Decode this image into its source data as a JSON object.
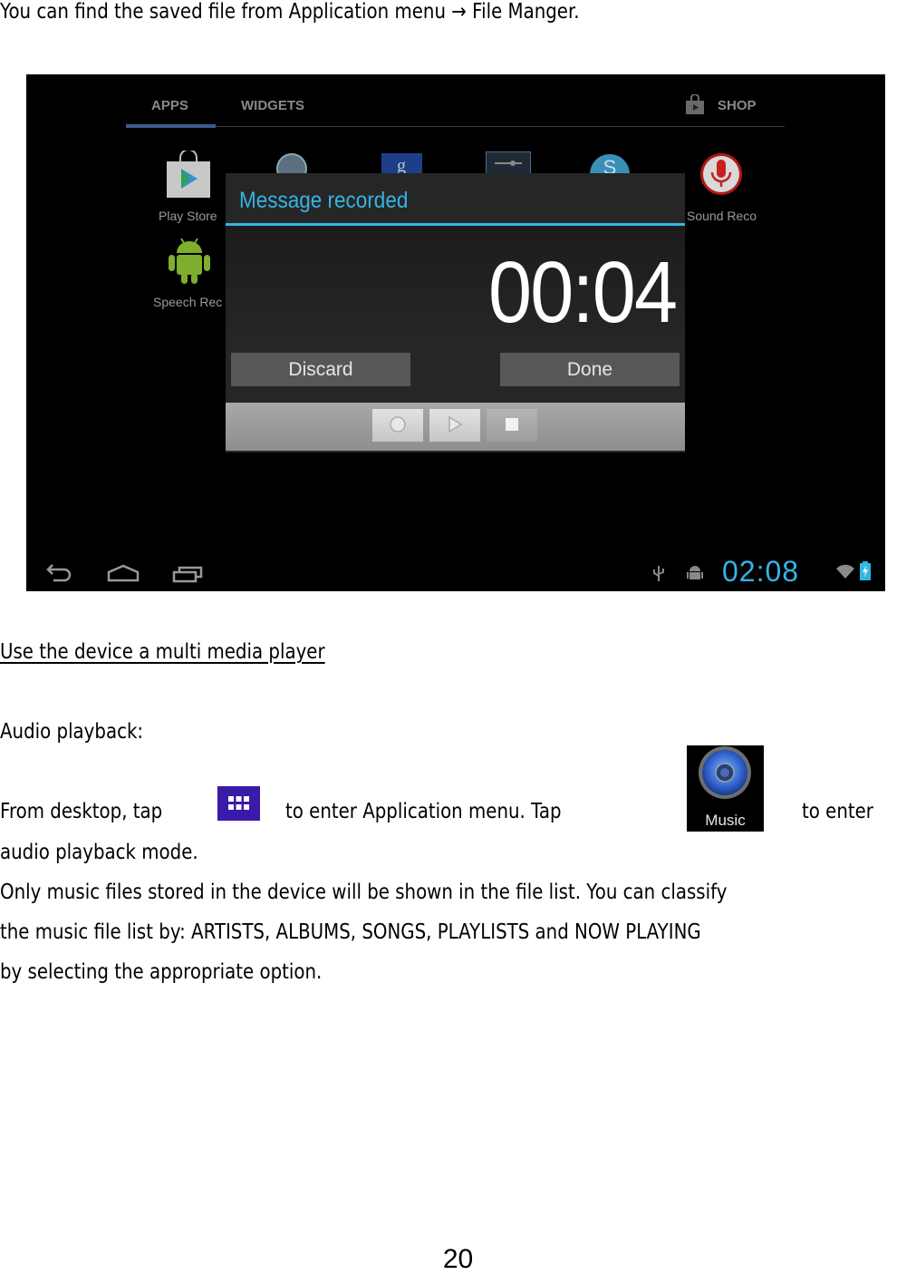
{
  "intro": {
    "text_before_arrow": "You can find the saved file from Application menu ",
    "arrow_icon": "right-arrow-icon",
    "text_after_arrow": " File Manger."
  },
  "screenshot": {
    "tabs": [
      {
        "label": "APPS",
        "selected": true
      },
      {
        "label": "WIDGETS",
        "selected": false
      }
    ],
    "shop_label": "SHOP",
    "apps": [
      {
        "label": "Play Store",
        "icon": "play-store-icon"
      },
      {
        "label": "Sound Reco",
        "icon": "microphone-icon"
      },
      {
        "label": "Speech Rec",
        "icon": "android-icon"
      }
    ],
    "background_icons": [
      "search-icon",
      "google-icon",
      "settings-icon",
      "skype-icon"
    ],
    "dialog": {
      "title": "Message recorded",
      "timer": "00:04",
      "discard_label": "Discard",
      "done_label": "Done",
      "controls": [
        "record-icon",
        "play-icon",
        "stop-icon"
      ]
    },
    "status_bar": {
      "clock": "02:08",
      "icons": [
        "usb-icon",
        "android-debug-icon",
        "wifi-icon",
        "battery-charging-icon"
      ]
    },
    "nav_icons": [
      "back-icon",
      "home-icon",
      "recent-apps-icon"
    ],
    "colors": {
      "accent": "#33b5e5",
      "tab_indicator": "#3c5a92"
    }
  },
  "section": {
    "heading": "Use the device a multi media player",
    "subheading": "Audio playback:",
    "p1_part1": "From desktop, tap",
    "p1_part2": "to enter Application menu.   Tap",
    "p1_part3": "to enter",
    "p1_line2": "audio playback mode.",
    "music_icon_label": "Music",
    "p2_line1": "Only music files stored in the device will be shown in the file list.   You can classify",
    "p2_line2": "the music file list by: ARTISTS, ALBUMS, SONGS, PLAYLISTS and NOW PLAYING",
    "p2_line3": "by selecting the appropriate option."
  },
  "page_number": "20"
}
